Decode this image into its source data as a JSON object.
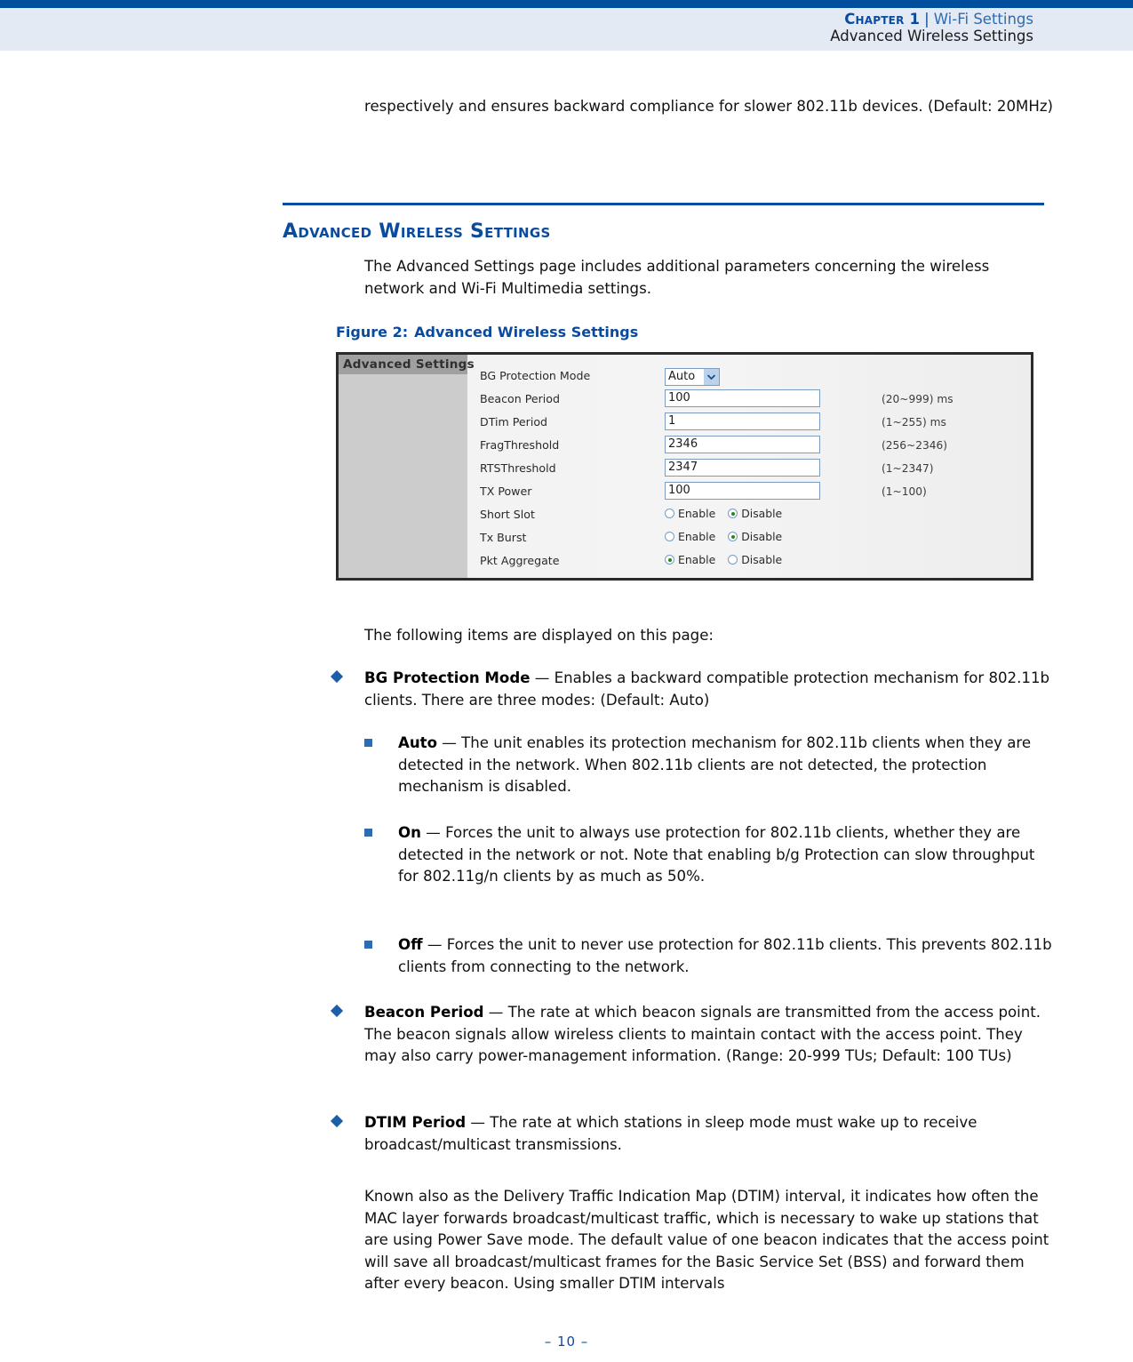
{
  "header": {
    "chapter_label": "Chapter 1",
    "separator": "|",
    "chapter_topic": "Wi-Fi Settings",
    "subtitle": "Advanced Wireless Settings"
  },
  "intro_paragraph": "respectively and ensures backward compliance for slower 802.11b devices. (Default: 20MHz)",
  "section": {
    "heading": "Advanced Wireless Settings",
    "intro": "The Advanced Settings page includes additional parameters concerning the wireless network and Wi-Fi Multimedia settings."
  },
  "figure": {
    "caption_number": "Figure 2:",
    "caption_title": "Advanced Wireless Settings",
    "panel_title": "Advanced Settings",
    "rows": [
      {
        "label": "BG Protection Mode",
        "type": "select",
        "value": "Auto",
        "hint": ""
      },
      {
        "label": "Beacon Period",
        "type": "text",
        "value": "100",
        "hint": "(20~999) ms"
      },
      {
        "label": "DTim Period",
        "type": "text",
        "value": "1",
        "hint": "(1~255) ms"
      },
      {
        "label": "FragThreshold",
        "type": "text",
        "value": "2346",
        "hint": "(256~2346)"
      },
      {
        "label": "RTSThreshold",
        "type": "text",
        "value": "2347",
        "hint": "(1~2347)"
      },
      {
        "label": "TX Power",
        "type": "text",
        "value": "100",
        "hint": "(1~100)"
      },
      {
        "label": "Short Slot",
        "type": "radio",
        "options": [
          "Enable",
          "Disable"
        ],
        "selected": "Disable",
        "hint": ""
      },
      {
        "label": "Tx Burst",
        "type": "radio",
        "options": [
          "Enable",
          "Disable"
        ],
        "selected": "Disable",
        "hint": ""
      },
      {
        "label": "Pkt Aggregate",
        "type": "radio",
        "options": [
          "Enable",
          "Disable"
        ],
        "selected": "Enable",
        "hint": ""
      }
    ]
  },
  "list_intro": "The following items are displayed on this page:",
  "items": {
    "bg_protection": {
      "term": "BG Protection Mode",
      "body": " — Enables a backward compatible protection mechanism for 802.11b clients. There are three modes: (Default: Auto)"
    },
    "auto": {
      "term": "Auto",
      "body": " — The unit enables its protection mechanism for 802.11b clients when they are detected in the network. When 802.11b clients are not detected, the protection mechanism is disabled."
    },
    "on": {
      "term": "On",
      "body": " — Forces the unit to always use protection for 802.11b clients, whether they are detected in the network or not. Note that enabling b/g Protection can slow throughput for 802.11g/n clients by as much as 50%."
    },
    "off": {
      "term": "Off",
      "body": " — Forces the unit to never use protection for 802.11b clients. This prevents 802.11b clients from connecting to the network."
    },
    "beacon_period": {
      "term": "Beacon Period",
      "body": " — The rate at which beacon signals are transmitted from the access point. The beacon signals allow wireless clients to maintain contact with the access point. They may also carry power-management information. (Range: 20-999 TUs; Default: 100 TUs)"
    },
    "dtim_period": {
      "term": "DTIM Period",
      "body": " — The rate at which stations in sleep mode must wake up to receive broadcast/multicast transmissions."
    }
  },
  "dtim_paragraph": "Known also as the Delivery Traffic Indication Map (DTIM) interval, it indicates how often the MAC layer forwards broadcast/multicast traffic, which is necessary to wake up stations that are using Power Save mode. The default value of one beacon indicates that the access point will save all broadcast/multicast frames for the Basic Service Set (BSS) and forward them after every beacon. Using smaller DTIM intervals",
  "footer": {
    "page_number": "–  10  –"
  },
  "colors": {
    "brand_blue": "#004f9e",
    "heading_blue": "#0a4b9e",
    "header_band": "#e3eaf4",
    "bullet_blue": "#1c5fa8",
    "radio_green": "#1e8b1e"
  }
}
